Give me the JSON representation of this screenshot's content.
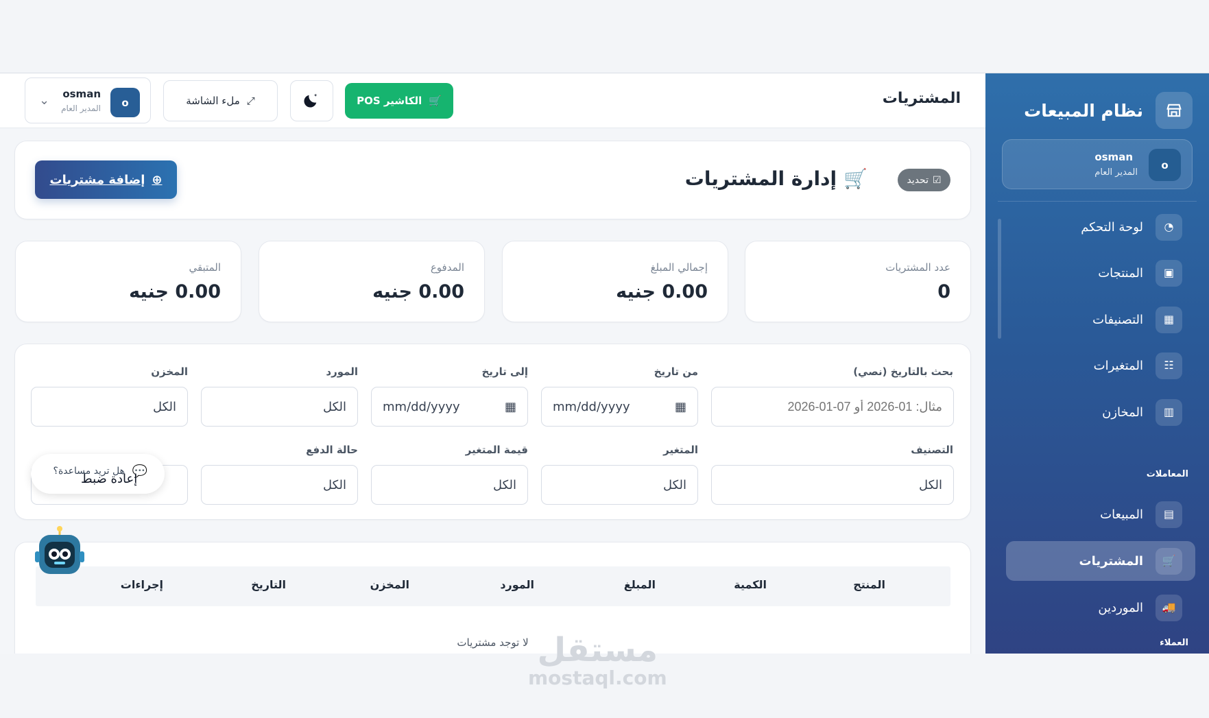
{
  "app": {
    "title": "نظام المبيعات"
  },
  "user": {
    "initial": "o",
    "name": "osman",
    "role": "المدير العام"
  },
  "sidebar": {
    "items": [
      {
        "label": "لوحة التحكم",
        "icon": "dashboard-icon"
      },
      {
        "label": "المنتجات",
        "icon": "box-icon"
      },
      {
        "label": "التصنيفات",
        "icon": "grid-icon"
      },
      {
        "label": "المتغيرات",
        "icon": "sliders-icon"
      },
      {
        "label": "المخازن",
        "icon": "building-icon"
      },
      {
        "label": "المبيعات",
        "icon": "receipt-icon"
      },
      {
        "label": "المشتريات",
        "icon": "cart-icon"
      },
      {
        "label": "الموردين",
        "icon": "truck-icon"
      }
    ],
    "sections": {
      "transactions": "المعاملات",
      "customers": "العملاء"
    }
  },
  "header": {
    "page_title": "المشتريات",
    "pos_label": "الكاشير POS",
    "fullscreen_label": "ملء الشاشة"
  },
  "page": {
    "manage_title": "إدارة المشتريات",
    "refresh_label": "تحديد",
    "add_label": "إضافة مشتريات"
  },
  "stats": [
    {
      "label": "عدد المشتريات",
      "value": "0"
    },
    {
      "label": "إجمالي المبلغ",
      "value": "0.00 جنيه"
    },
    {
      "label": "المدفوع",
      "value": "0.00 جنيه"
    },
    {
      "label": "المتبقي",
      "value": "0.00 جنيه"
    }
  ],
  "filters": {
    "date_search": {
      "label": "بحث بالتاريخ (نصي)",
      "placeholder": "مثال: 01-2026 أو 07-01-2026"
    },
    "from": {
      "label": "من تاريخ",
      "value": "mm/dd/yyyy"
    },
    "to": {
      "label": "إلى تاريخ",
      "value": "mm/dd/yyyy"
    },
    "supplier": {
      "label": "المورد",
      "value": "الكل"
    },
    "warehouse": {
      "label": "المخزن",
      "value": "الكل"
    },
    "category": {
      "label": "التصنيف",
      "value": "الكل"
    },
    "variant": {
      "label": "المتغير",
      "value": "الكل"
    },
    "variant_value": {
      "label": "قيمة المتغير",
      "value": "الكل"
    },
    "payment_status": {
      "label": "حالة الدفع",
      "value": "الكل"
    },
    "reset": "إعادة ضبط"
  },
  "help": {
    "text": "هل تريد مساعدة؟"
  },
  "table": {
    "columns": [
      "المنتج",
      "الكمية",
      "المبلغ",
      "المورد",
      "المخزن",
      "التاريخ",
      "إجراءات"
    ],
    "empty_text": "لا توجد مشتريات"
  },
  "watermark": {
    "arabic": "مستقل",
    "latin": "mostaql.com"
  },
  "colors": {
    "sidebar_top": "#2f6fab",
    "sidebar_bottom": "#2f4383",
    "pos_green": "#16b46f",
    "primary_blue": "#324b8d"
  }
}
